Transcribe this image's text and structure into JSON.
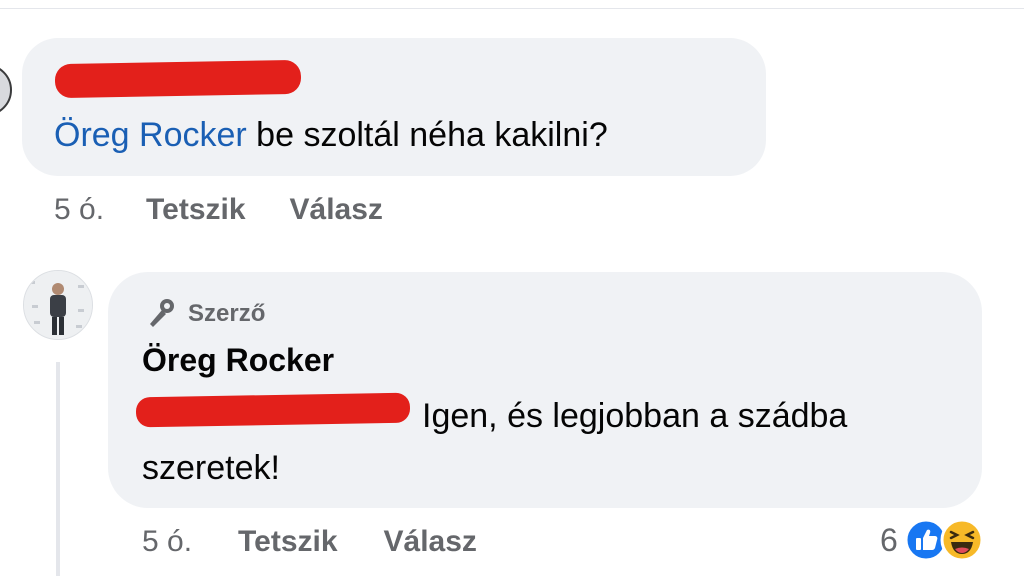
{
  "comment1": {
    "mention": "Öreg Rocker",
    "text": " be szoltál néha kakilni?",
    "time": "5 ó.",
    "like_label": "Tetszik",
    "reply_label": "Válasz"
  },
  "reply": {
    "author_badge": "Szerző",
    "author_name": "Öreg Rocker",
    "text": "Igen, és legjobban a szádba szeretek!",
    "time": "5 ó.",
    "like_label": "Tetszik",
    "reply_label": "Válasz",
    "reaction_count": "6",
    "reactions": [
      "like-icon",
      "haha-icon"
    ]
  },
  "colors": {
    "bubble": "#f0f2f5",
    "mention": "#1a5fb4",
    "meta": "#65676b",
    "redaction": "#e3201b",
    "like_blue": "#1877f2",
    "haha_yellow": "#f7b928"
  }
}
